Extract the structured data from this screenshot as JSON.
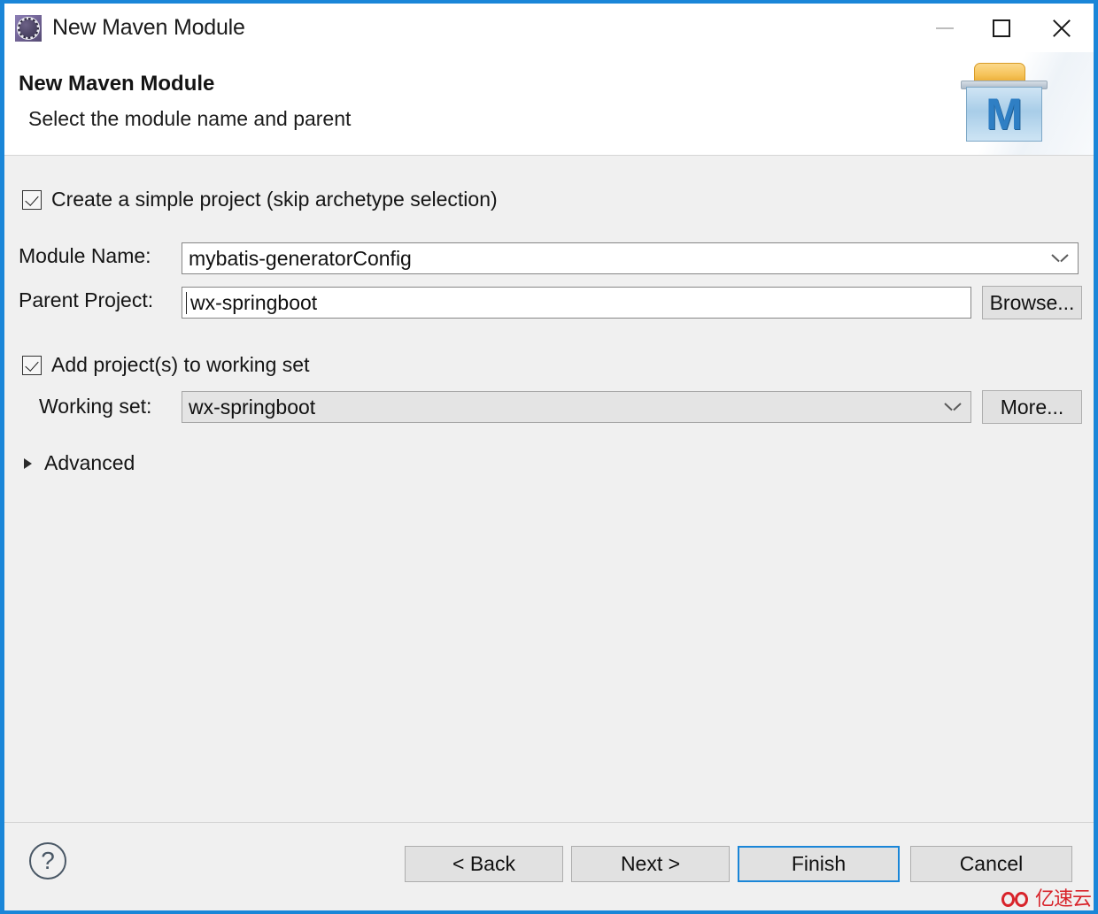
{
  "window": {
    "title": "New Maven Module",
    "icon": "maven-module-gear-icon",
    "controls": {
      "minimize": "minimize-icon",
      "maximize": "maximize-icon",
      "close": "close-icon"
    },
    "accent_color": "#1a86d8"
  },
  "header": {
    "title": "New Maven Module",
    "subtitle": "Select the module name and parent",
    "banner_icon": "maven-folder-logo",
    "banner_letter": "M"
  },
  "form": {
    "simple_project_checkbox": {
      "label": "Create a simple project (skip archetype selection)",
      "checked": true
    },
    "module_name": {
      "label": "Module Name:",
      "value": "mybatis-generatorConfig",
      "placeholder": ""
    },
    "parent_project": {
      "label": "Parent Project:",
      "value": "wx-springboot",
      "placeholder": "",
      "browse_button": "Browse..."
    },
    "working_set_checkbox": {
      "label": "Add project(s) to working set",
      "checked": true
    },
    "working_set": {
      "label": "Working set:",
      "value": "wx-springboot",
      "more_button": "More..."
    },
    "advanced": {
      "label": "Advanced",
      "expanded": false
    }
  },
  "footer": {
    "help_icon": "?",
    "buttons": {
      "back": "< Back",
      "next": "Next >",
      "finish": "Finish",
      "cancel": "Cancel"
    },
    "default_button": "Finish"
  },
  "watermark": {
    "text": "亿速云",
    "color": "#d8232a"
  }
}
